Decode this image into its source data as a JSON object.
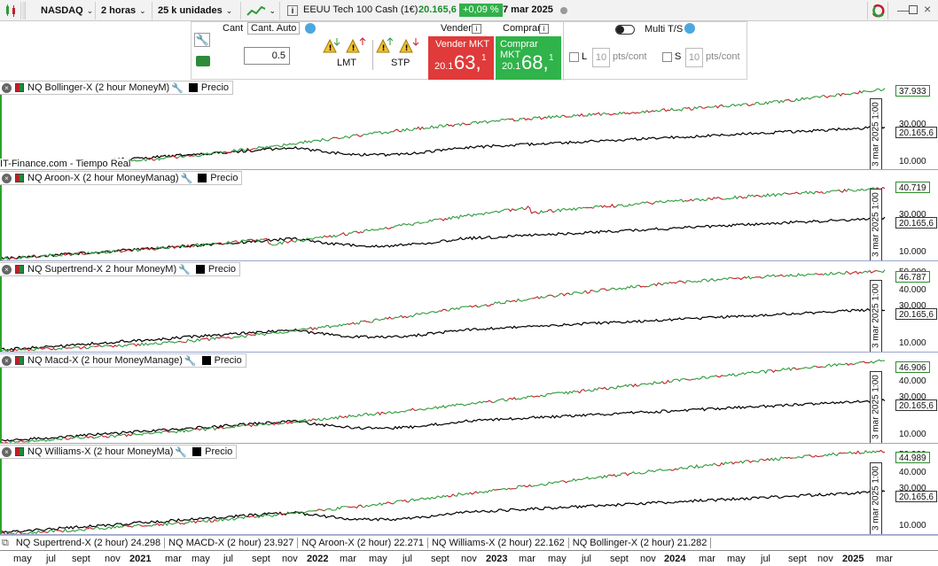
{
  "toolbar": {
    "market": "NASDAQ",
    "timeframe": "2 horas",
    "units": "25 k unidades",
    "instrument": "EEUU Tech 100 Cash (1€)",
    "price": "20.165,6",
    "change": "+0,09 %",
    "date": "7 mar 2025"
  },
  "order": {
    "cant_label": "Cant",
    "cant_auto": "Cant. Auto",
    "qty": "0.5",
    "lmt": "LMT",
    "stp": "STP",
    "sell_header": "Vender",
    "buy_header": "Comprar",
    "sell_label": "Vender MKT",
    "buy_label": "Comprar MKT",
    "sell_prefix": "20.1",
    "sell_big": "63,",
    "sell_sup": "1",
    "buy_prefix": "20.1",
    "buy_big": "68,",
    "buy_sup": "1",
    "multi_ts": "Multi T/S",
    "l_label": "L",
    "l_value": "10",
    "l_unit": "pts/cont",
    "s_label": "S",
    "s_value": "10",
    "s_unit": "pts/cont"
  },
  "panes": [
    {
      "title": "NQ Bollinger-X (2 hour MoneyM)",
      "price_label": "Precio",
      "value": "37.933",
      "price": "20.165,6",
      "date": "3 mar 2025 1:00",
      "ticks": [
        "30.000",
        "10.000"
      ],
      "footer": "IT-Finance.com - Tiempo Real"
    },
    {
      "title": "NQ Aroon-X (2 hour MoneyManag)",
      "price_label": "Precio",
      "value": "40.719",
      "price": "20.165,6",
      "date": "3 mar 2025 1:00",
      "ticks": [
        "30.000",
        "10.000"
      ]
    },
    {
      "title": "NQ Supertrend-X 2 hour MoneyM)",
      "price_label": "Precio",
      "value": "46.787",
      "price": "20.165,6",
      "date": "3 mar 2025 1:00",
      "ticks": [
        "50.000",
        "40.000",
        "30.000",
        "10.000"
      ]
    },
    {
      "title": "NQ Macd-X (2 hour MoneyManage)",
      "price_label": "Precio",
      "value": "46.906",
      "price": "20.165,6",
      "date": "3 mar 2025 1:00",
      "ticks": [
        "40.000",
        "30.000",
        "10.000"
      ]
    },
    {
      "title": "NQ Williams-X (2 hour MoneyMa)",
      "price_label": "Precio",
      "value": "44.989",
      "price": "20.165,6",
      "date": "3 mar 2025 1:00",
      "ticks": [
        "50.000",
        "40.000",
        "30.000",
        "10.000"
      ]
    }
  ],
  "summary": [
    {
      "name": "NQ Supertrend-X (2 hour)",
      "value": "24.298"
    },
    {
      "name": "NQ MACD-X (2 hour)",
      "value": "23.927"
    },
    {
      "name": "NQ Aroon-X (2 hour)",
      "value": "22.271"
    },
    {
      "name": "NQ Williams-X (2 hour)",
      "value": "22.162"
    },
    {
      "name": "NQ Bollinger-X (2 hour)",
      "value": "21.282"
    }
  ],
  "xaxis": [
    "may",
    "jul",
    "sept",
    "nov",
    "2021",
    "mar",
    "may",
    "jul",
    "sept",
    "nov",
    "2022",
    "mar",
    "may",
    "jul",
    "sept",
    "nov",
    "2023",
    "mar",
    "may",
    "jul",
    "sept",
    "nov",
    "2024",
    "mar",
    "may",
    "jul",
    "sept",
    "nov",
    "2025",
    "mar"
  ],
  "colors": {
    "up": "#2e9a3a",
    "down": "#c0202a",
    "sell": "#e03a3a",
    "buy": "#2fb34a",
    "price": "#000000"
  }
}
